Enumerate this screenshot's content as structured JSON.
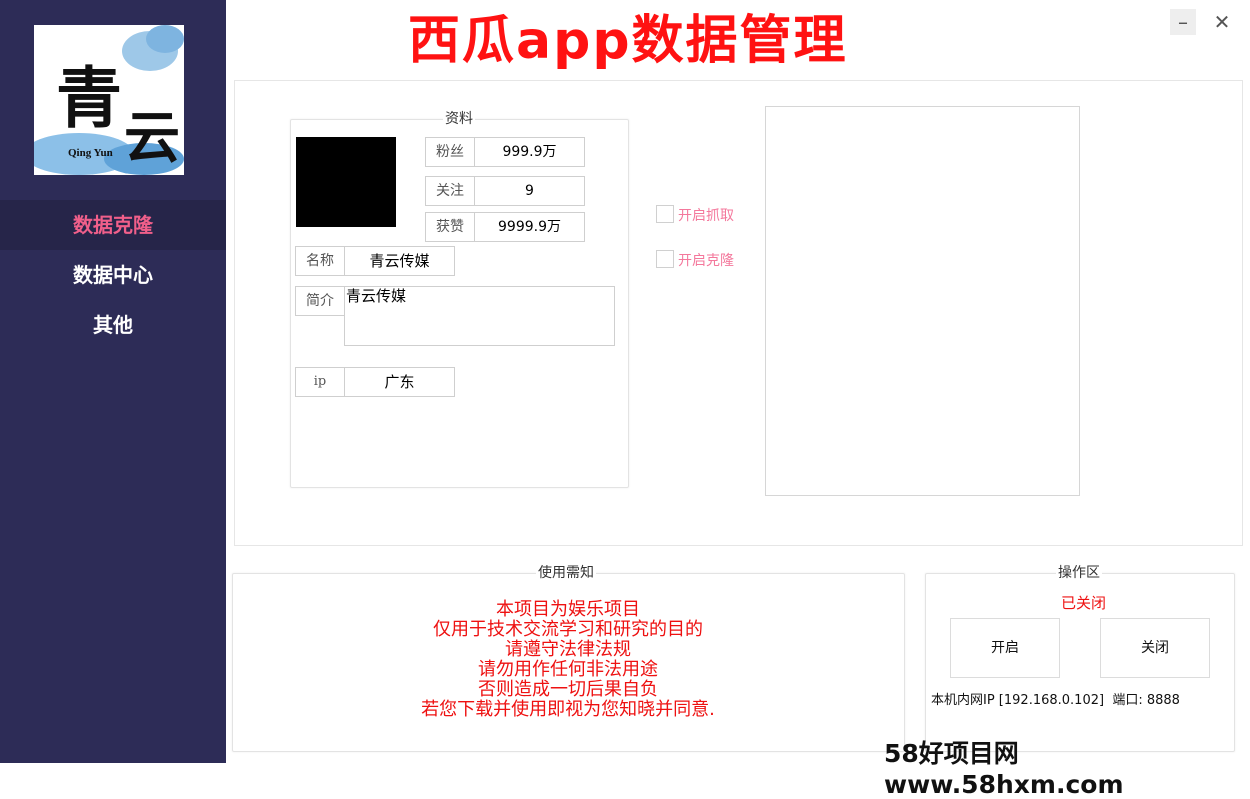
{
  "app": {
    "title": "西瓜app数据管理"
  },
  "window": {
    "minimize_icon": "minimize-icon",
    "close_icon": "close-icon"
  },
  "logo": {
    "main_char1": "青",
    "main_char2": "云",
    "subtitle": "Qing Yun"
  },
  "sidebar": {
    "items": [
      {
        "label": "数据克隆",
        "active": true
      },
      {
        "label": "数据中心",
        "active": false
      },
      {
        "label": "其他",
        "active": false
      }
    ]
  },
  "profile": {
    "group_title": "资料",
    "fans_label": "粉丝",
    "fans_value": "999.9万",
    "follow_label": "关注",
    "follow_value": "9",
    "likes_label": "获赞",
    "likes_value": "9999.9万",
    "name_label": "名称",
    "name_value": "青云传媒",
    "bio_label": "简介",
    "bio_value": "青云传媒",
    "ip_label": "ip",
    "ip_value": "广东"
  },
  "options": {
    "capture_label": "开启抓取",
    "capture_checked": false,
    "clone_label": "开启克隆",
    "clone_checked": false
  },
  "notice": {
    "title": "使用需知",
    "lines": [
      "本项目为娱乐项目",
      "仅用于技术交流学习和研究的目的",
      "请遵守法律法规",
      "请勿用作任何非法用途",
      "否则造成一切后果自负",
      "若您下载并使用即视为您知晓并同意."
    ]
  },
  "operations": {
    "title": "操作区",
    "status": "已关闭",
    "start_label": "开启",
    "stop_label": "关闭",
    "ip_info": "本机内网IP [192.168.0.102]  端口: 8888"
  },
  "watermark": {
    "text": "58好项目网www.58hxm.com"
  },
  "colors": {
    "sidebar_bg": "#2d2c57",
    "active_nav": "#f05f8a",
    "title_red": "#ff1212",
    "notice_red": "#ee1111",
    "checkbox_label": "#f4789c"
  }
}
